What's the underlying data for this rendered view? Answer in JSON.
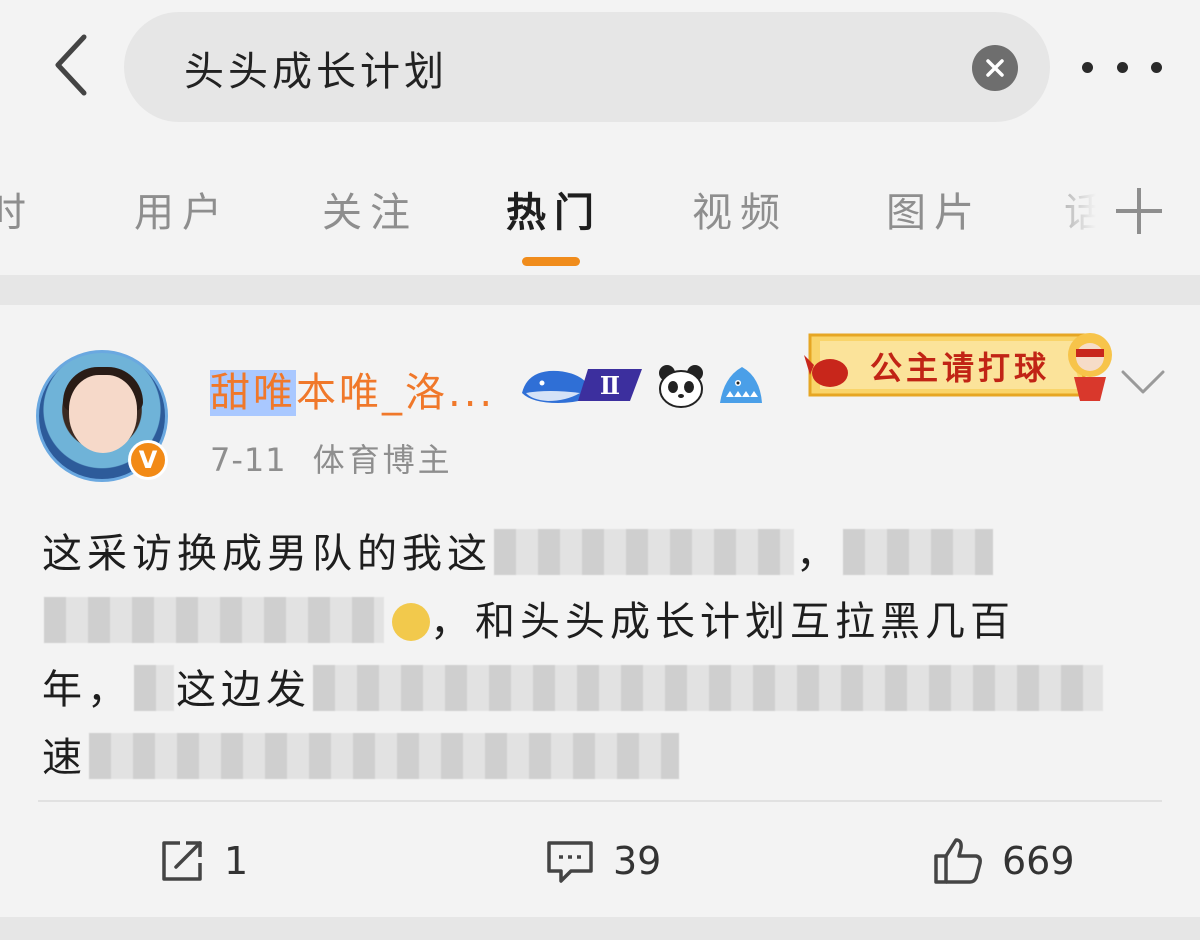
{
  "search": {
    "query": "头头成长计划"
  },
  "tabs": [
    {
      "label": "时"
    },
    {
      "label": "用户"
    },
    {
      "label": "关注"
    },
    {
      "label": "热门"
    },
    {
      "label": "视频"
    },
    {
      "label": "图片"
    },
    {
      "label": "话"
    }
  ],
  "active_tab": "热门",
  "post": {
    "username_highlight": "甜唯",
    "username_rest": "本唯_洛...",
    "member_level": "Ⅱ",
    "verified_mark": "V",
    "banner_text": "公主请打球",
    "date": "7-11",
    "author_tag": "体育博主",
    "text_line1_start": "这采访换成男队的我这",
    "text_line1_end": "，",
    "text_line2_mid": "，和头头成长计划互拉黑几百",
    "text_line3_start": "年，",
    "text_line3_mid": "这边发",
    "text_line4_start": "速",
    "repost_count": "1",
    "comment_count": "39",
    "like_count": "669"
  },
  "colors": {
    "accent": "#f08c1c",
    "username": "#f0782a",
    "highlight": "#a9c8ff",
    "banner_red": "#c12415"
  },
  "icons": [
    "back-arrow-icon",
    "clear-icon",
    "more-icon",
    "add-tab-icon",
    "verified-icon",
    "chevron-down-icon",
    "repost-icon",
    "comment-icon",
    "like-icon"
  ]
}
